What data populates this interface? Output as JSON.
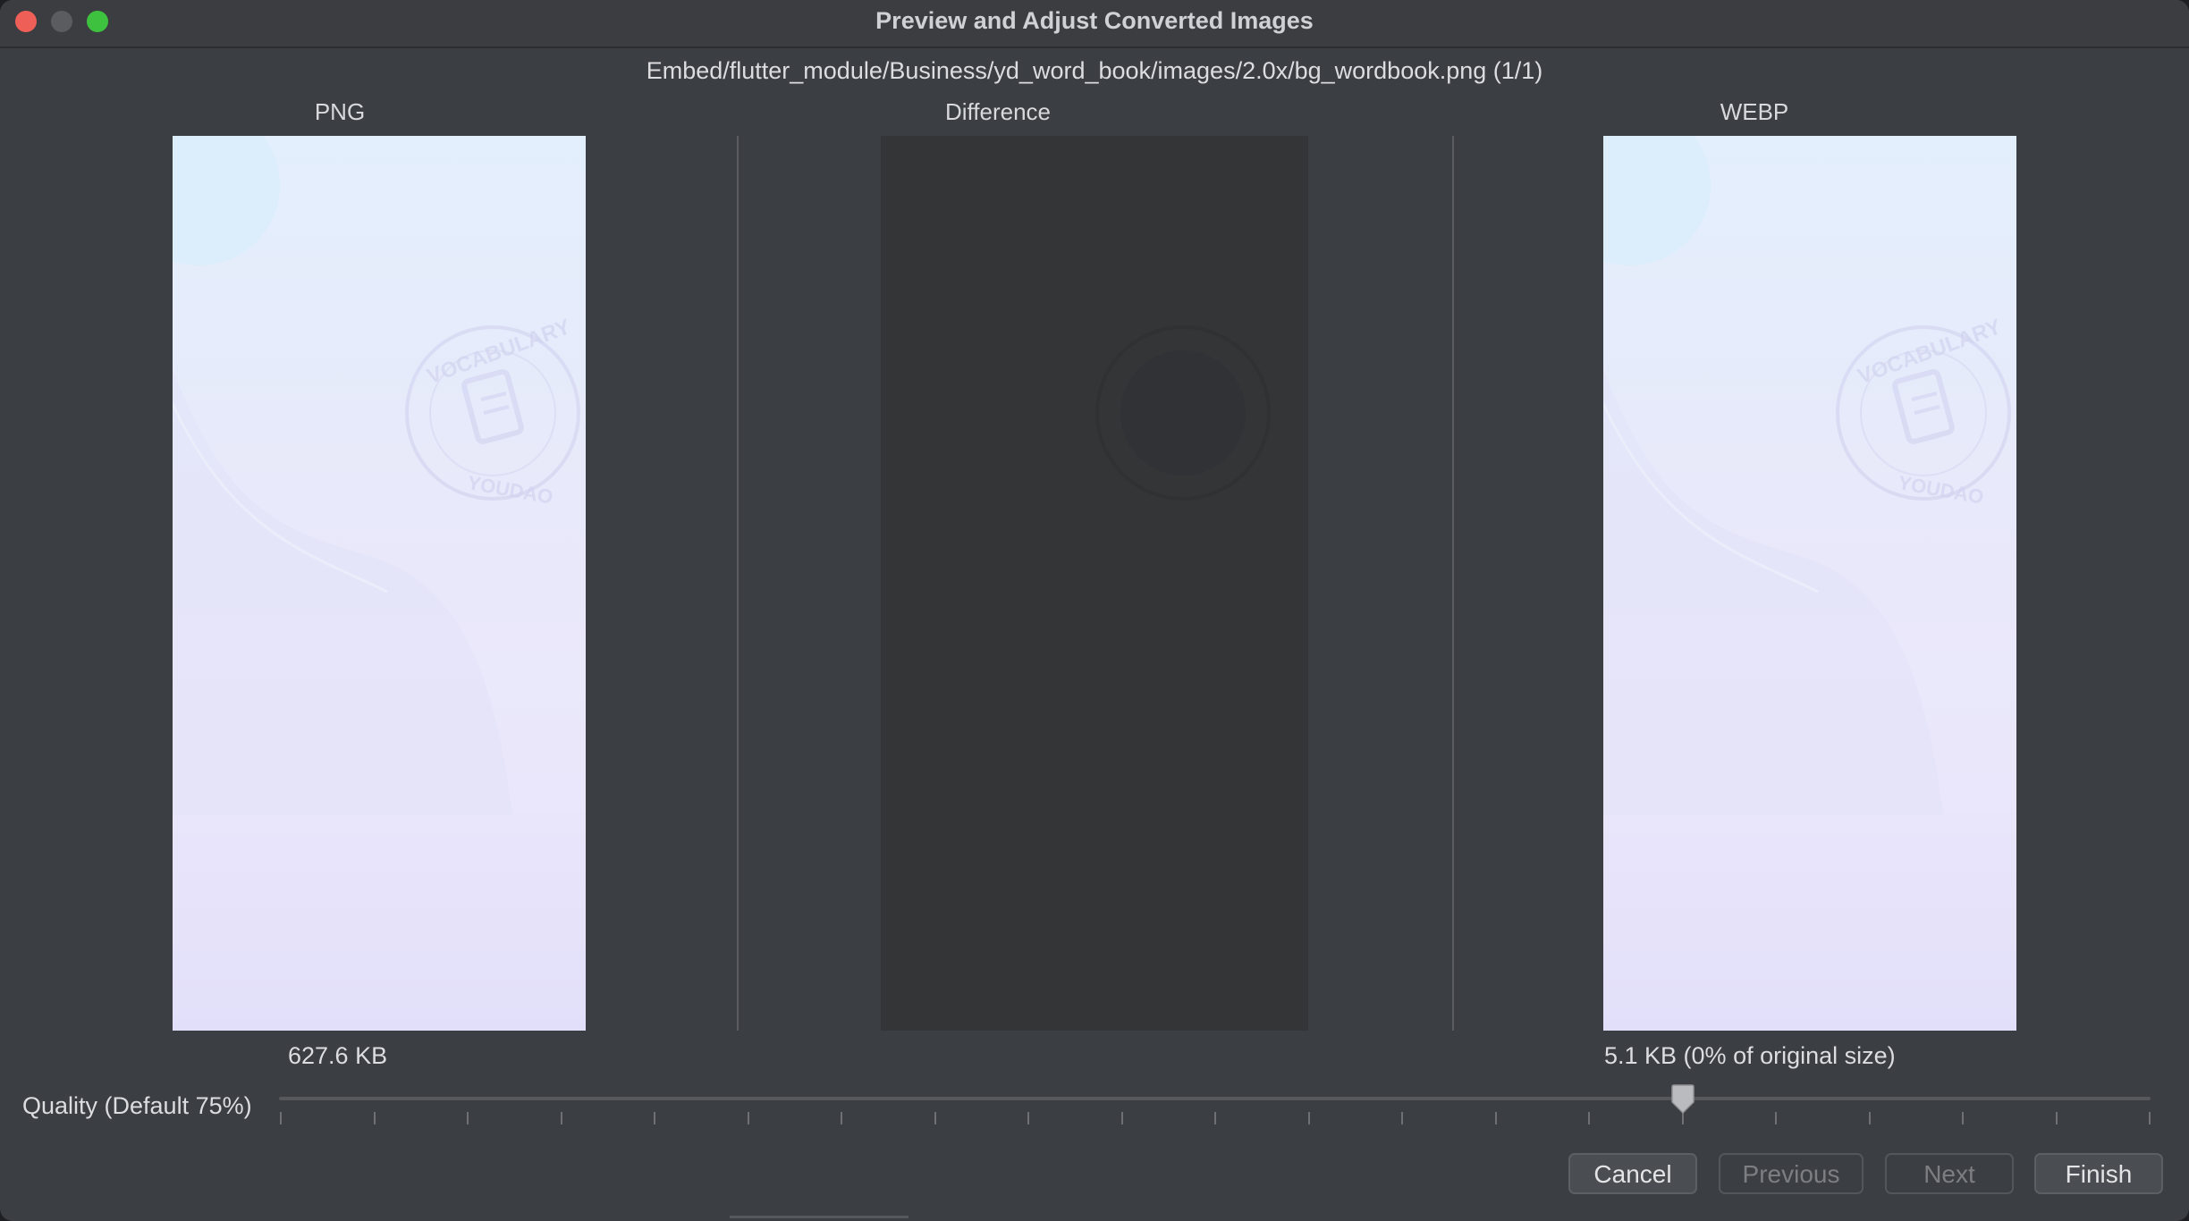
{
  "window": {
    "title": "Preview and Adjust Converted Images"
  },
  "file": {
    "path": "Embed/flutter_module/Business/yd_word_book/images/2.0x/bg_wordbook.png (1/1)"
  },
  "panels": {
    "png_label": "PNG",
    "difference_label": "Difference",
    "webp_label": "WEBP"
  },
  "stamp": {
    "top_text": "VOCABULARY",
    "bottom_text": "YOUDAO"
  },
  "sizes": {
    "png_size": "627.6 KB",
    "webp_size": "5.1 KB (0% of original size)"
  },
  "quality": {
    "label": "Quality (Default 75%)",
    "value_percent": 75
  },
  "buttons": {
    "cancel": "Cancel",
    "previous": "Previous",
    "next": "Next",
    "finish": "Finish"
  },
  "colors": {
    "close": "#ee5f57",
    "minimize": "#5a5c60",
    "maximize": "#3fc140",
    "window_bg": "#3b3e42"
  }
}
